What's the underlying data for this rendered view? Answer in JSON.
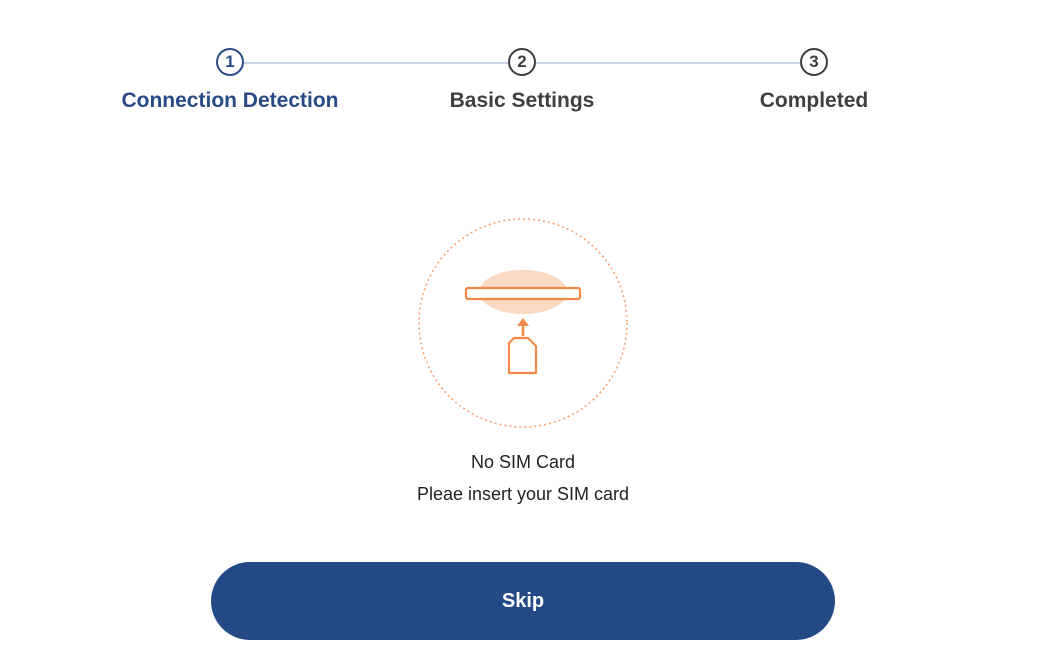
{
  "stepper": {
    "steps": [
      {
        "number": "1",
        "label": "Connection Detection",
        "state": "active"
      },
      {
        "number": "2",
        "label": "Basic Settings",
        "state": "pending"
      },
      {
        "number": "3",
        "label": "Completed",
        "state": "pending"
      }
    ]
  },
  "illustration": {
    "icon": "sim-card-insert-icon",
    "accent_color": "#f08a46",
    "highlight_color": "#fbd9c3"
  },
  "status": {
    "title": "No SIM Card",
    "message": "Pleae insert your SIM card"
  },
  "actions": {
    "skip_label": "Skip"
  },
  "colors": {
    "primary": "#234a86",
    "active_step": "#2a4a86",
    "inactive_step": "#3f3f3f",
    "line": "#c9d3e6"
  }
}
